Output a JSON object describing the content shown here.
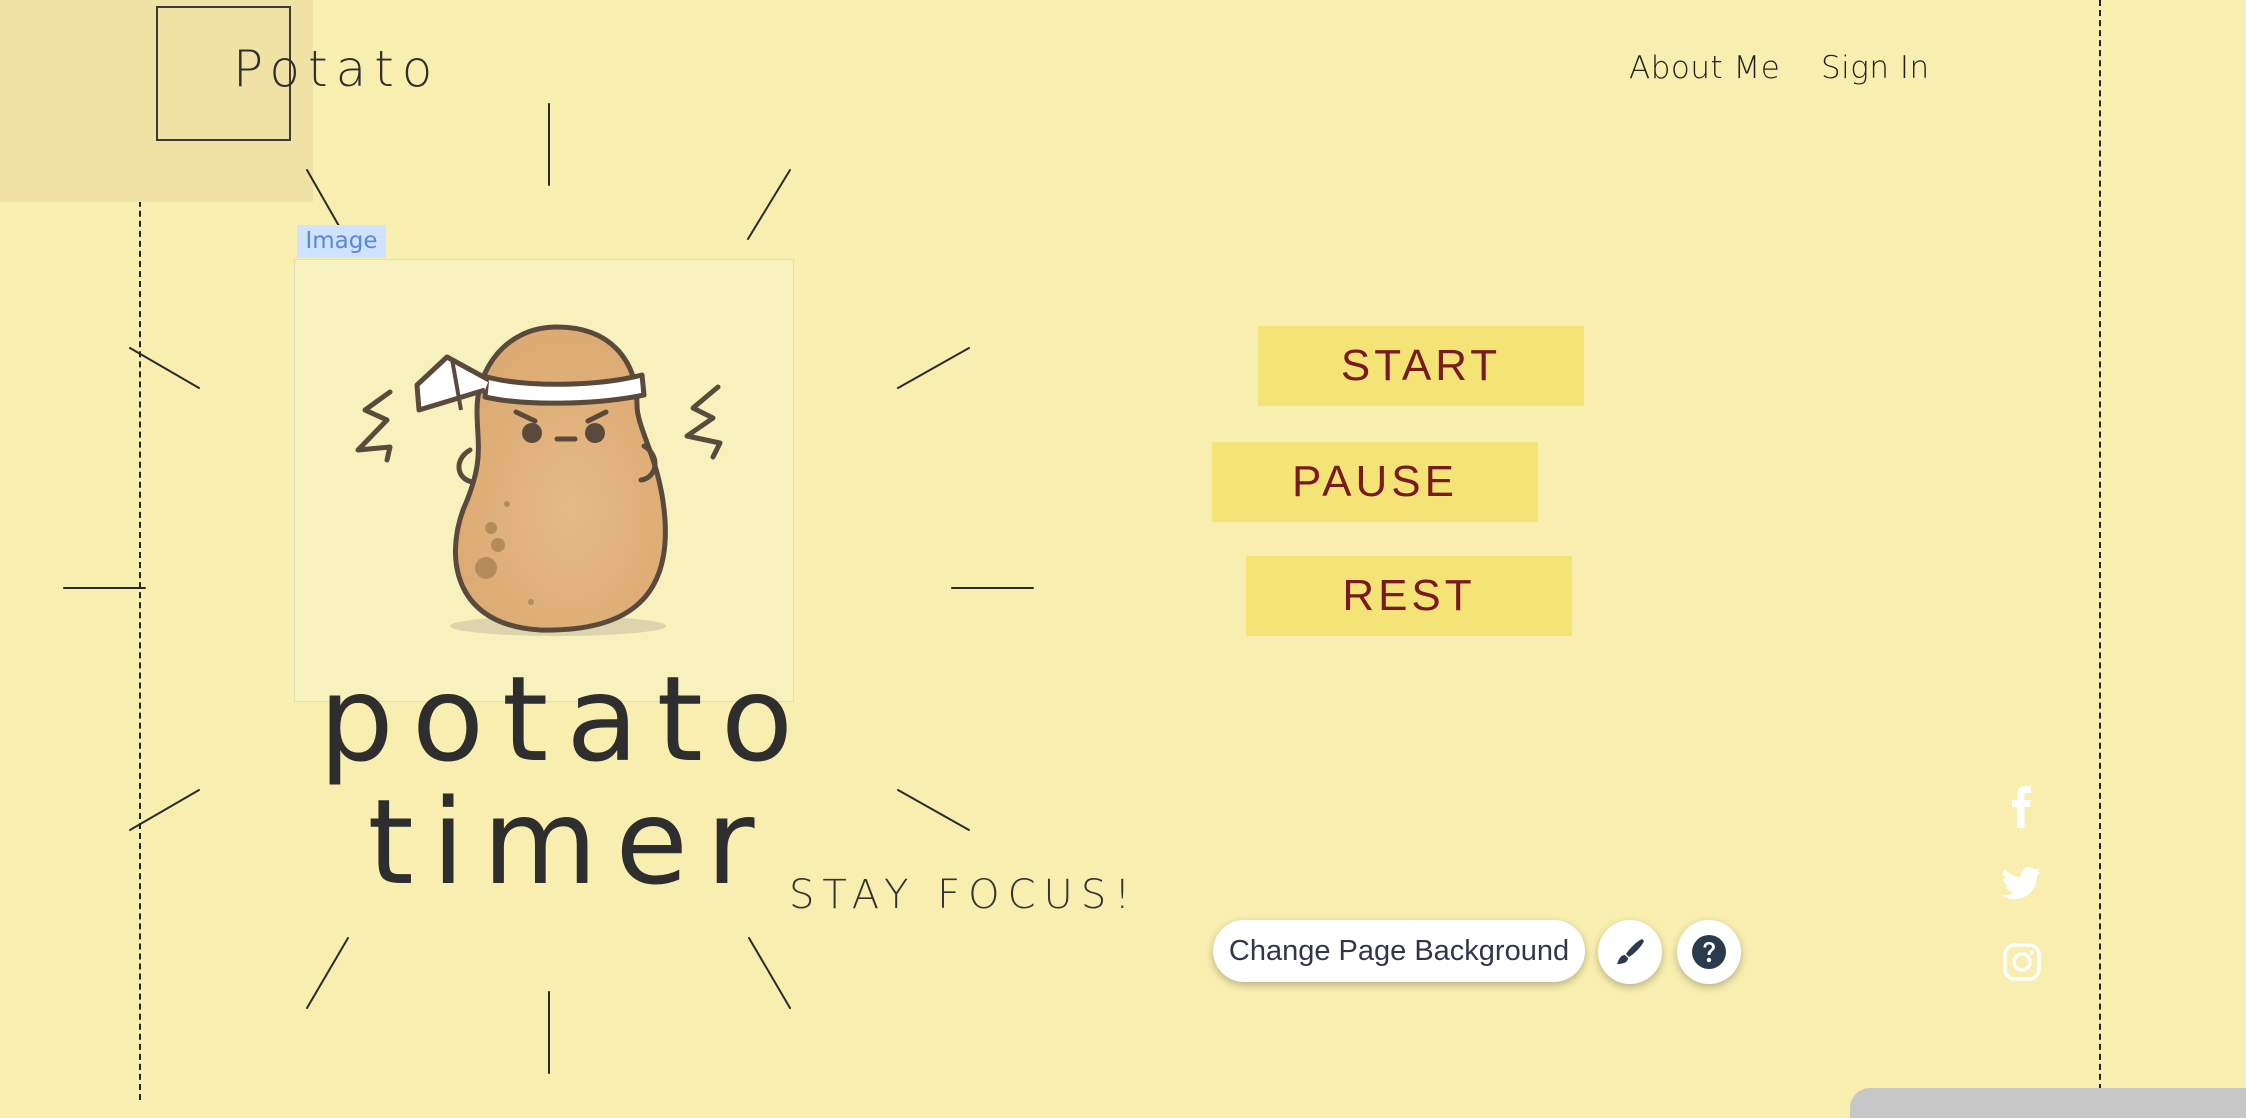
{
  "logo": {
    "text": "Potato"
  },
  "nav": {
    "items": [
      {
        "label": "About Me"
      },
      {
        "label": "Sign In"
      }
    ]
  },
  "editor": {
    "image_tag": "Image"
  },
  "hero": {
    "title_line1": "potato",
    "title_line2": "timer",
    "tagline": "STAY FOCUS!"
  },
  "timer": {
    "start_label": "START",
    "pause_label": "PAUSE",
    "rest_label": "REST"
  },
  "tools": {
    "change_bg_label": "Change Page Background"
  },
  "social": {
    "icons": [
      "facebook-icon",
      "twitter-icon",
      "instagram-icon"
    ]
  },
  "colors": {
    "background": "#f8eeaf",
    "logo_block": "#efe2a4",
    "button_bg": "#f4e475",
    "button_text": "#7a1a1f",
    "title_text": "#2e2e2e"
  }
}
